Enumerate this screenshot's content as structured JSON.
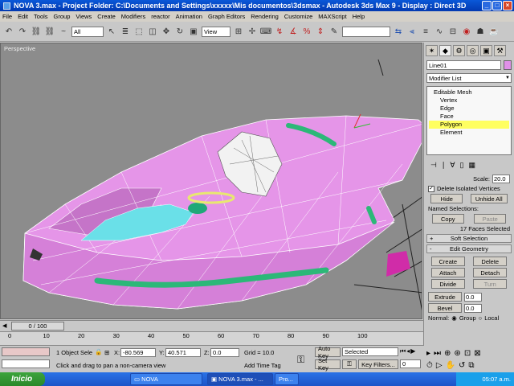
{
  "window": {
    "title": "NOVA 3.max   -   Project Folder: C:\\Documents and Settings\\xxxxx\\Mis documentos\\3dsmax   -   Autodesk 3ds Max 9   -   Display : Direct 3D"
  },
  "menu": [
    "File",
    "Edit",
    "Tools",
    "Group",
    "Views",
    "Create",
    "Modifiers",
    "reactor",
    "Animation",
    "Graph Editors",
    "Rendering",
    "Customize",
    "MAXScript",
    "Help"
  ],
  "toolbar": {
    "selection_filter": "All",
    "ref_coord": "View"
  },
  "viewport": {
    "label": "Perspective"
  },
  "command_panel": {
    "object_name": "Line01",
    "modifier_list": "Modifier List",
    "stack": [
      {
        "label": "Editable Mesh",
        "level": 0,
        "selected": false
      },
      {
        "label": "Vertex",
        "level": 1,
        "selected": false
      },
      {
        "label": "Edge",
        "level": 1,
        "selected": false
      },
      {
        "label": "Face",
        "level": 1,
        "selected": false
      },
      {
        "label": "Polygon",
        "level": 1,
        "selected": true
      },
      {
        "label": "Element",
        "level": 1,
        "selected": false
      }
    ],
    "scale_label": "Scale:",
    "scale_value": "20.0",
    "delete_isolated": "Delete Isolated Vertices",
    "hide": "Hide",
    "unhide_all": "Unhide All",
    "named_selections": "Named Selections:",
    "copy": "Copy",
    "paste": "Paste",
    "faces_selected": "17 Faces Selected",
    "soft_selection": "Soft Selection",
    "edit_geometry": "Edit Geometry",
    "create": "Create",
    "delete": "Delete",
    "attach": "Attach",
    "detach": "Detach",
    "divide": "Divide",
    "turn": "Turn",
    "extrude": "Extrude",
    "extrude_val": "0.0",
    "bevel": "Bevel",
    "bevel_val": "0.0",
    "normal": "Normal:",
    "group": "Group",
    "local": "Local"
  },
  "timeline": {
    "frame": "0 / 100",
    "ticks": [
      "0",
      "10",
      "20",
      "30",
      "40",
      "50",
      "60",
      "70",
      "80",
      "90",
      "100"
    ]
  },
  "status": {
    "selected": "1 Object Sele",
    "x_label": "X:",
    "x": "-80.569",
    "y_label": "Y:",
    "y": "40.571",
    "z_label": "Z:",
    "z": "0.0",
    "grid": "Grid = 10.0",
    "prompt": "Click and drag to pan a non-camera view",
    "add_time_tag": "Add Time Tag",
    "auto_key": "Auto Key",
    "set_key": "Set Key",
    "key_mode": "Selected",
    "key_filters": "Key Filters...",
    "frame_field": "0"
  },
  "taskbar": {
    "start": "Inicio",
    "tasks": [
      "NOVA",
      "NOVA 3.max - ...",
      "Pro..."
    ],
    "clock": "05:07 a.m."
  },
  "colors": {
    "mesh": "#e595e8",
    "selection": "#ffff60",
    "accent": "#3ca0ec"
  }
}
